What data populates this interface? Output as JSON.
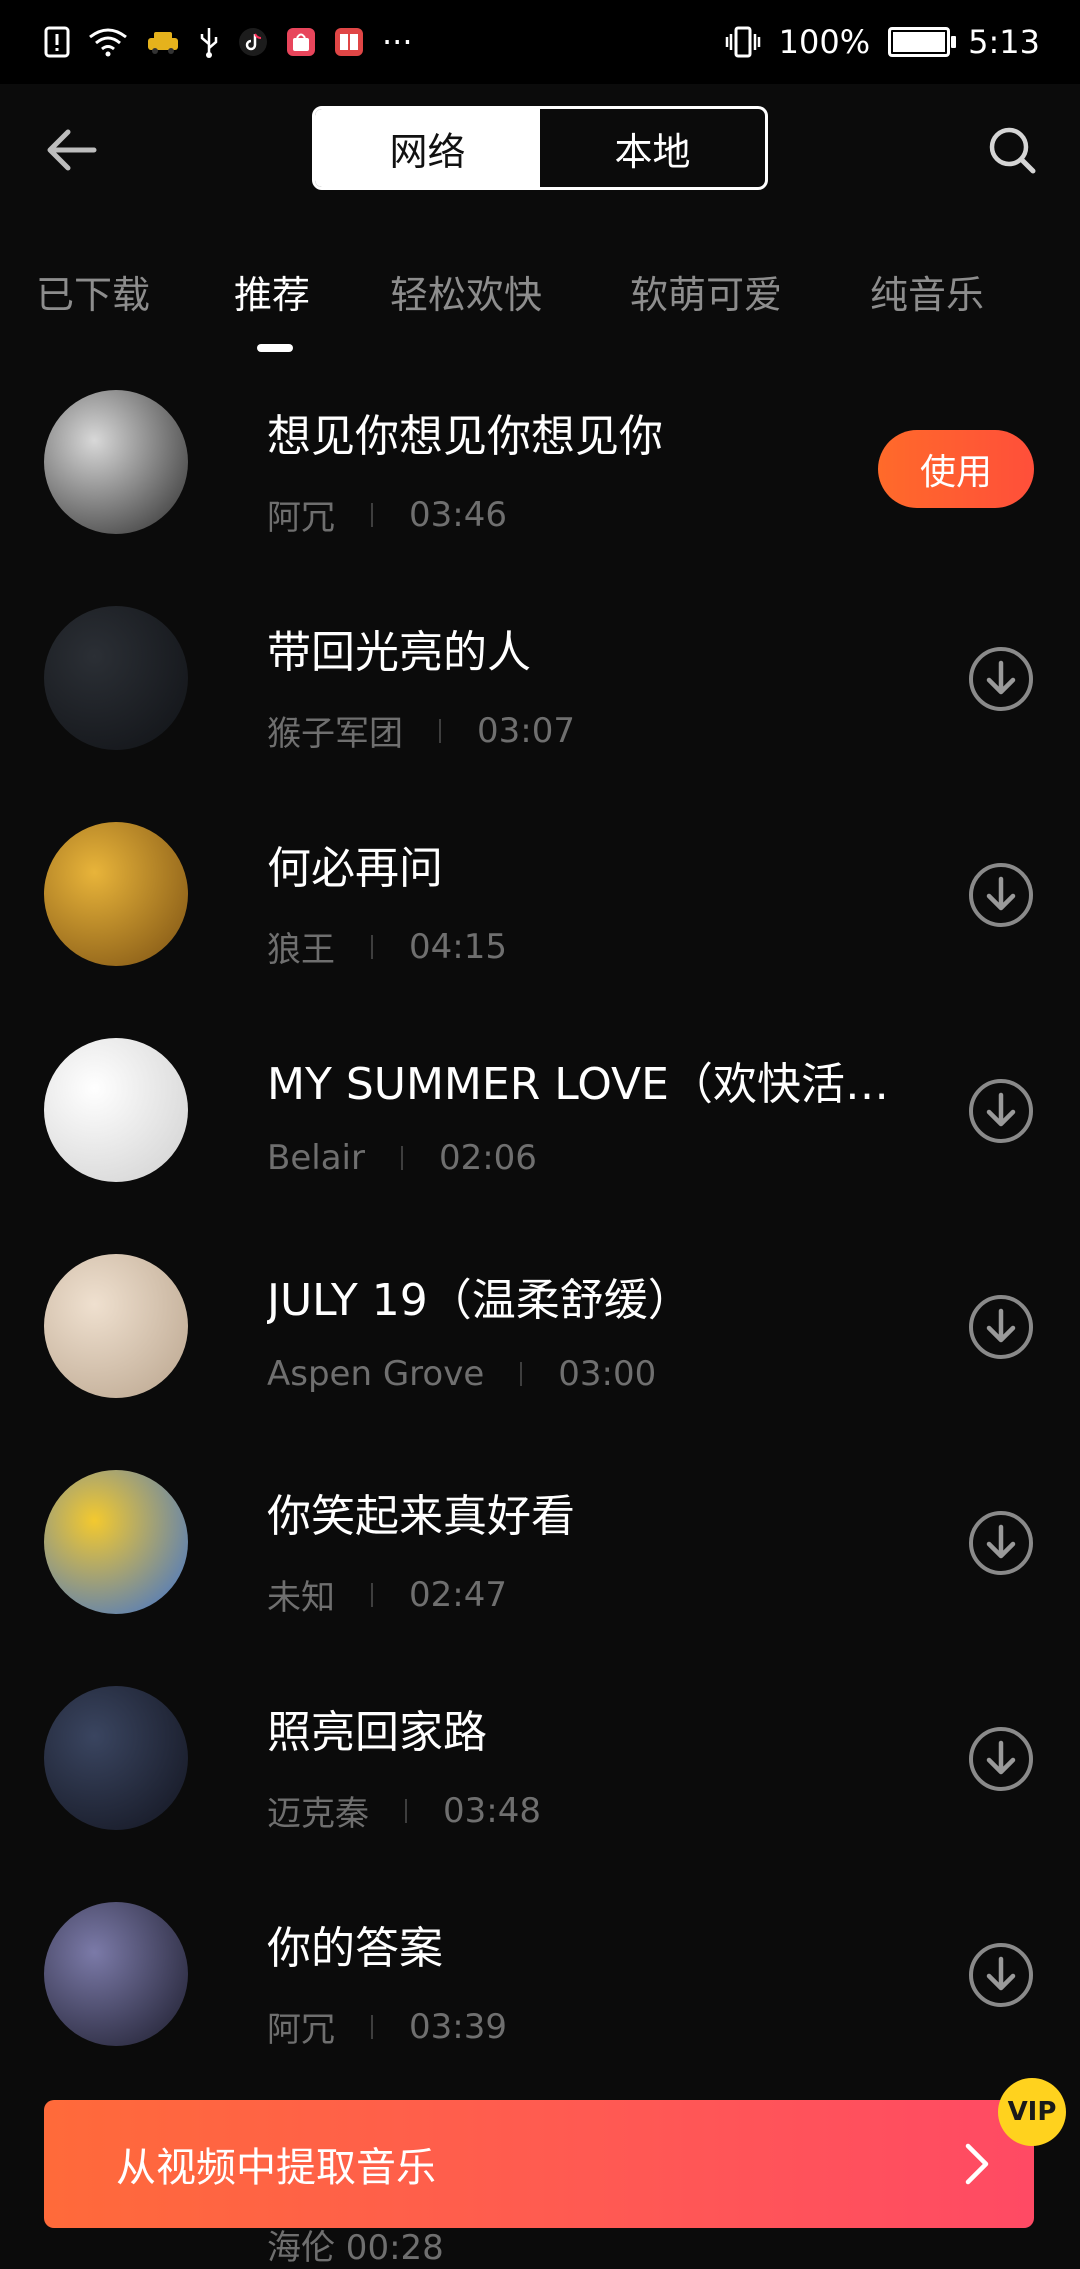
{
  "status_bar": {
    "battery_percent": "100%",
    "battery_level": 1.0,
    "time": "5:13",
    "more_indicator": "···"
  },
  "header": {
    "segments": [
      {
        "label": "网络",
        "active": true
      },
      {
        "label": "本地",
        "active": false
      }
    ]
  },
  "tabs": [
    {
      "label": "已下载",
      "active": false
    },
    {
      "label": "推荐",
      "active": true
    },
    {
      "label": "轻松欢快",
      "active": false
    },
    {
      "label": "软萌可爱",
      "active": false
    },
    {
      "label": "纯音乐",
      "active": false
    }
  ],
  "songs": [
    {
      "title": "想见你想见你想见你",
      "artist": "阿冗",
      "duration": "03:46",
      "action": "use",
      "action_label": "使用",
      "cover_colors": [
        "#d8d8d8",
        "#2a2a2a"
      ]
    },
    {
      "title": "带回光亮的人",
      "artist": "猴子军团",
      "duration": "03:07",
      "action": "download",
      "cover_colors": [
        "#2b2f35",
        "#101216"
      ]
    },
    {
      "title": "何必再问",
      "artist": "狼王",
      "duration": "04:15",
      "action": "download",
      "cover_colors": [
        "#e8b43a",
        "#7a4f12"
      ]
    },
    {
      "title": "MY SUMMER LOVE（欢快活泼）",
      "artist": "Belair",
      "duration": "02:06",
      "action": "download",
      "cover_colors": [
        "#ffffff",
        "#cfcfcf"
      ]
    },
    {
      "title": "JULY 19（温柔舒缓）",
      "artist": "Aspen Grove",
      "duration": "03:00",
      "action": "download",
      "cover_colors": [
        "#efe0cf",
        "#b9a48d"
      ]
    },
    {
      "title": "你笑起来真好看",
      "artist": "未知",
      "duration": "02:47",
      "action": "download",
      "cover_colors": [
        "#f3c92f",
        "#3a6fd1"
      ]
    },
    {
      "title": "照亮回家路",
      "artist": "迈克秦",
      "duration": "03:48",
      "action": "download",
      "cover_colors": [
        "#3a4560",
        "#12141f"
      ]
    },
    {
      "title": "你的答案",
      "artist": "阿冗",
      "duration": "03:39",
      "action": "download",
      "cover_colors": [
        "#7b7aa8",
        "#1b1b2b"
      ]
    }
  ],
  "extract_bar": {
    "label": "从视频中提取音乐",
    "badge": "VIP"
  },
  "peek_row": {
    "text": "海伦    00:28"
  },
  "colors": {
    "background": "#0b0b0b",
    "accent": "#ff5a3c",
    "muted_text": "#6f6f6f",
    "inactive_tab": "#8d8d8d",
    "vip": "#ffd21e"
  }
}
